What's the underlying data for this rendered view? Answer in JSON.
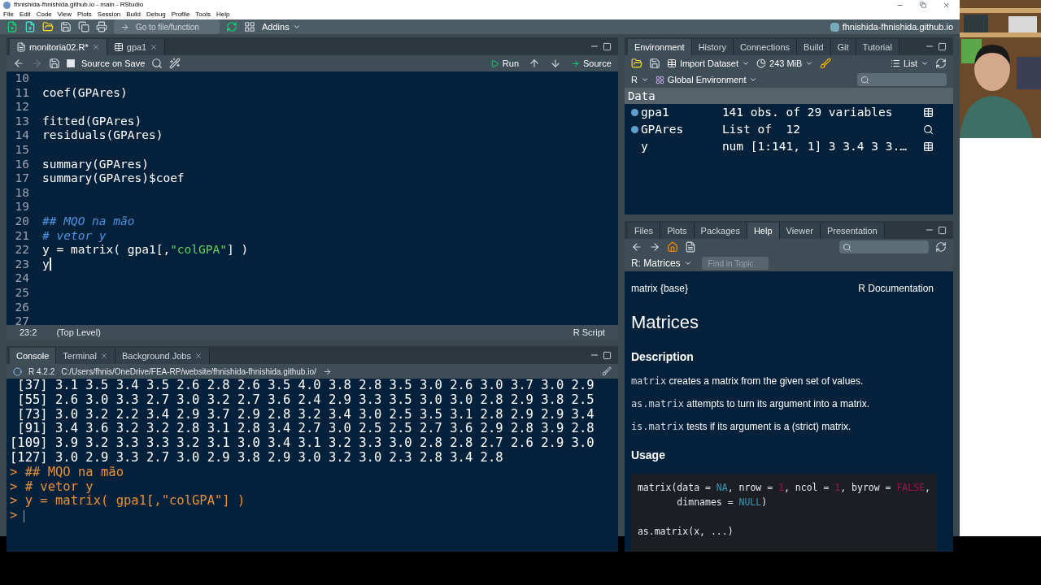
{
  "window": {
    "title": "fhnishida-fhnishida.github.io - main - RStudio"
  },
  "menu": [
    "File",
    "Edit",
    "Code",
    "View",
    "Plots",
    "Session",
    "Build",
    "Debug",
    "Profile",
    "Tools",
    "Help"
  ],
  "main_toolbar": {
    "goto_placeholder": "Go to file/function",
    "addins": "Addins",
    "project": "fhnishida-fhnishida.github.io"
  },
  "editor": {
    "tabs": [
      {
        "label": "monitoria02.R*",
        "kind": "script",
        "selected": true,
        "closable": true
      },
      {
        "label": "gpa1",
        "kind": "table",
        "selected": false,
        "closable": true
      }
    ],
    "source_on_save": {
      "label": "Source on Save",
      "checked": false
    },
    "run": "Run",
    "source": "Source",
    "lines": [
      {
        "number": "10",
        "cursor": false
      },
      {
        "number": "11",
        "cursor": false,
        "segments": [
          {
            "text": "coef(GPAres)",
            "kind": "code"
          }
        ]
      },
      {
        "number": "12",
        "cursor": false
      },
      {
        "number": "13",
        "cursor": false,
        "segments": [
          {
            "text": "fitted(GPAres)",
            "kind": "code"
          }
        ]
      },
      {
        "number": "14",
        "cursor": false,
        "segments": [
          {
            "text": "residuals(GPAres)",
            "kind": "code"
          }
        ]
      },
      {
        "number": "15",
        "cursor": false
      },
      {
        "number": "16",
        "cursor": false,
        "segments": [
          {
            "text": "summary(GPAres)",
            "kind": "code"
          }
        ]
      },
      {
        "number": "17",
        "cursor": false,
        "segments": [
          {
            "text": "summary(GPAres)$coef",
            "kind": "code"
          }
        ]
      },
      {
        "number": "18",
        "cursor": false
      },
      {
        "number": "19",
        "cursor": false
      },
      {
        "number": "20",
        "cursor": false,
        "segments": [
          {
            "text": "## MQO na mão",
            "kind": "comment"
          }
        ]
      },
      {
        "number": "21",
        "cursor": false,
        "segments": [
          {
            "text": "# vetor y",
            "kind": "comment"
          }
        ]
      },
      {
        "number": "22",
        "cursor": false,
        "segments": [
          {
            "text": "y = matrix( gpa1[,",
            "kind": "code"
          },
          {
            "text": "\"colGPA\"",
            "kind": "string"
          },
          {
            "text": "] )",
            "kind": "code"
          }
        ]
      },
      {
        "number": "23",
        "cursor": true,
        "segments": [
          {
            "text": "y",
            "kind": "code"
          }
        ]
      },
      {
        "number": "24",
        "cursor": false
      },
      {
        "number": "25",
        "cursor": false
      },
      {
        "number": "26",
        "cursor": false
      },
      {
        "number": "27",
        "cursor": false
      }
    ],
    "status": {
      "position": "23:2",
      "scope": "(Top Level)",
      "file_type": "R Script"
    }
  },
  "console": {
    "tabs": [
      {
        "label": "Console",
        "selected": true,
        "closable": false
      },
      {
        "label": "Terminal",
        "selected": false,
        "closable": true
      },
      {
        "label": "Background Jobs",
        "selected": false,
        "closable": true
      }
    ],
    "version": "R 4.2.2",
    "path": "C:/Users/fhnis/OneDrive/FEA-RP/website/fhnishida-fhnishida.github.io/",
    "lines": [
      {
        "text": " [37] 3.1 3.5 3.4 3.5 2.6 2.8 2.6 3.5 4.0 3.8 2.8 3.5 3.0 2.6 3.0 3.7 3.0 2.9",
        "kind": "output"
      },
      {
        "text": " [55] 2.6 3.0 3.3 2.7 3.0 3.2 2.7 3.6 2.4 2.9 3.3 3.5 3.0 3.0 2.8 2.9 3.8 2.5",
        "kind": "output"
      },
      {
        "text": " [73] 3.0 3.2 2.2 3.4 2.9 3.7 2.9 2.8 3.2 3.4 3.0 2.5 3.5 3.1 2.8 2.9 2.9 3.4",
        "kind": "output"
      },
      {
        "text": " [91] 3.4 3.6 3.2 3.2 2.8 3.1 2.8 3.4 2.7 3.0 2.5 2.5 2.7 3.6 2.9 2.8 3.9 2.8",
        "kind": "output"
      },
      {
        "text": "[109] 3.9 3.2 3.3 3.3 3.2 3.1 3.0 3.4 3.1 3.2 3.3 3.0 2.8 2.8 2.7 2.6 2.9 3.0",
        "kind": "output"
      },
      {
        "text": "[127] 3.0 2.9 3.3 2.7 3.0 2.9 3.8 2.9 3.0 3.2 3.0 2.3 2.8 3.4 2.8",
        "kind": "output"
      },
      {
        "text": "> ## MQO na mão",
        "kind": "input"
      },
      {
        "text": "> # vetor y",
        "kind": "input"
      },
      {
        "text": "> y = matrix( gpa1[,\"colGPA\"] )",
        "kind": "input"
      },
      {
        "text": ">",
        "kind": "prompt"
      }
    ]
  },
  "environment": {
    "tabs": [
      {
        "label": "Environment",
        "selected": true
      },
      {
        "label": "History",
        "selected": false
      },
      {
        "label": "Connections",
        "selected": false
      },
      {
        "label": "Build",
        "selected": false
      },
      {
        "label": "Git",
        "selected": false
      },
      {
        "label": "Tutorial",
        "selected": false
      }
    ],
    "import_dataset": "Import Dataset",
    "memory": "243 MiB",
    "view_mode": "List",
    "language": "R",
    "scope": "Global Environment",
    "section": "Data",
    "rows": [
      {
        "name": "gpa1",
        "value": "141 obs. of 29 variables",
        "expandable": true,
        "kind": "data"
      },
      {
        "name": "GPAres",
        "value": "List of  12",
        "expandable": true,
        "kind": "list"
      },
      {
        "name": "y",
        "value": "num [1:141, 1] 3 3.4 3 3.…",
        "expandable": false,
        "kind": "value"
      }
    ]
  },
  "help": {
    "tabs": [
      {
        "label": "Files",
        "selected": false
      },
      {
        "label": "Plots",
        "selected": false
      },
      {
        "label": "Packages",
        "selected": false
      },
      {
        "label": "Help",
        "selected": true
      },
      {
        "label": "Viewer",
        "selected": false
      },
      {
        "label": "Presentation",
        "selected": false
      }
    ],
    "topic": "R: Matrices",
    "find_placeholder": "Find in Topic",
    "doc": {
      "package": "matrix {base}",
      "source": "R Documentation",
      "title": "Matrices",
      "description_heading": "Description",
      "paragraphs": [
        {
          "code": "matrix",
          "text": " creates a matrix from the given set of values."
        },
        {
          "code": "as.matrix",
          "text": " attempts to turn its argument into a matrix."
        },
        {
          "code": "is.matrix",
          "text": " tests if its argument is a (strict) matrix."
        }
      ],
      "usage_heading": "Usage",
      "usage_lines": [
        {
          "kind": "code",
          "segments": [
            {
              "text": "matrix(data = ",
              "kind": "plain"
            },
            {
              "text": "NA",
              "kind": "constant"
            },
            {
              "text": ", nrow = ",
              "kind": "plain"
            },
            {
              "text": "1",
              "kind": "number"
            },
            {
              "text": ", ncol = ",
              "kind": "plain"
            },
            {
              "text": "1",
              "kind": "number"
            },
            {
              "text": ", byrow = ",
              "kind": "plain"
            },
            {
              "text": "FALSE",
              "kind": "number"
            },
            {
              "text": ",",
              "kind": "plain"
            }
          ]
        },
        {
          "kind": "code",
          "segments": [
            {
              "text": "       dimnames = ",
              "kind": "plain"
            },
            {
              "text": "NULL",
              "kind": "constant"
            },
            {
              "text": ")",
              "kind": "plain"
            }
          ]
        },
        {
          "kind": "blank"
        },
        {
          "kind": "code",
          "segments": [
            {
              "text": "as.matrix(x, ...)",
              "kind": "plain"
            }
          ]
        }
      ]
    }
  }
}
